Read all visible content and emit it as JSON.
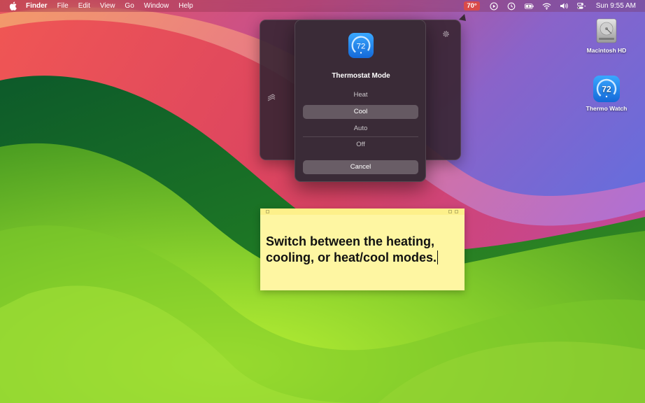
{
  "menubar": {
    "app_name": "Finder",
    "items": [
      "File",
      "Edit",
      "View",
      "Go",
      "Window",
      "Help"
    ],
    "temperature": "70°",
    "clock": "Sun 9:55 AM"
  },
  "desktop": {
    "icons": [
      {
        "label": "Macintosh HD",
        "icon": "hard-drive-icon"
      },
      {
        "label": "Thermo Watch",
        "icon": "thermostat-app-icon"
      }
    ]
  },
  "mode_sheet": {
    "icon_value": "72",
    "title": "Thermostat Mode",
    "options": [
      {
        "label": "Heat",
        "selected": false
      },
      {
        "label": "Cool",
        "selected": true
      },
      {
        "label": "Auto",
        "selected": false
      },
      {
        "label": "Off",
        "selected": false
      }
    ],
    "cancel_label": "Cancel"
  },
  "sticky_note": {
    "text": "Switch between the heating, cooling, or heat/cool modes."
  },
  "colors": {
    "accent_blue": "#1e8ff0",
    "sticky_yellow": "#fef6a2",
    "temp_badge": "#d94a4a"
  }
}
